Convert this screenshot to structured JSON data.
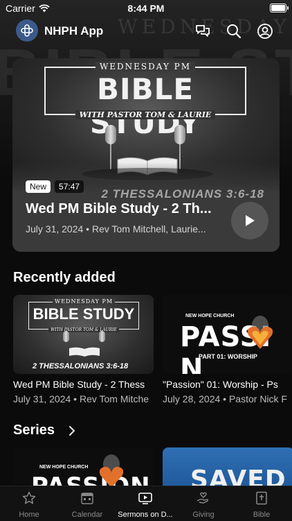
{
  "status_bar": {
    "carrier": "Carrier",
    "time": "8:44 PM"
  },
  "header": {
    "app_name": "NHPH App",
    "icons": [
      "chat-bubbles-icon",
      "search-icon",
      "profile-icon"
    ]
  },
  "background_art": {
    "line1": "WEDNESDAY PM",
    "line2": "BIBLE STUDY"
  },
  "featured": {
    "art_top": "WEDNESDAY PM",
    "art_title": "BIBLE STUDY",
    "art_subtitle": "WITH PASTOR TOM & LAURIE",
    "art_scripture": "2 THESSALONIANS 3:6-18",
    "badge_new": "New",
    "duration": "57:47",
    "title": "Wed PM Bible Study - 2 Th...",
    "meta": "July 31, 2024 • Rev Tom Mitchell, Laurie..."
  },
  "recently_added": {
    "heading": "Recently added",
    "items": [
      {
        "art_top": "WEDNESDAY PM",
        "art_title": "BIBLE STUDY",
        "art_subtitle": "WITH PASTOR TOM & LAURIE",
        "art_scripture": "2 THESSALONIANS 3:6-18",
        "title": "Wed PM Bible Study - 2 Thess",
        "meta": "July 31, 2024 • Rev Tom Mitche"
      },
      {
        "art_church": "NEW HOPE CHURCH",
        "art_title": "PASSI N",
        "art_subtitle": "PART 01: WORSHIP",
        "title": "\"Passion\" 01: Worship - Ps",
        "meta": "July 28, 2024 • Pastor Nick F"
      }
    ]
  },
  "series": {
    "heading": "Series",
    "items": [
      {
        "art_church": "NEW HOPE CHURCH",
        "art_title": "PASSION"
      },
      {
        "art_title": "SAVED"
      }
    ]
  },
  "tabbar": {
    "tabs": [
      {
        "label": "Home",
        "icon": "star-icon"
      },
      {
        "label": "Calendar",
        "icon": "calendar-icon"
      },
      {
        "label": "Sermons on D...",
        "icon": "tv-play-icon",
        "active": true
      },
      {
        "label": "Giving",
        "icon": "giving-hand-icon"
      },
      {
        "label": "Bible",
        "icon": "bible-icon"
      }
    ]
  }
}
